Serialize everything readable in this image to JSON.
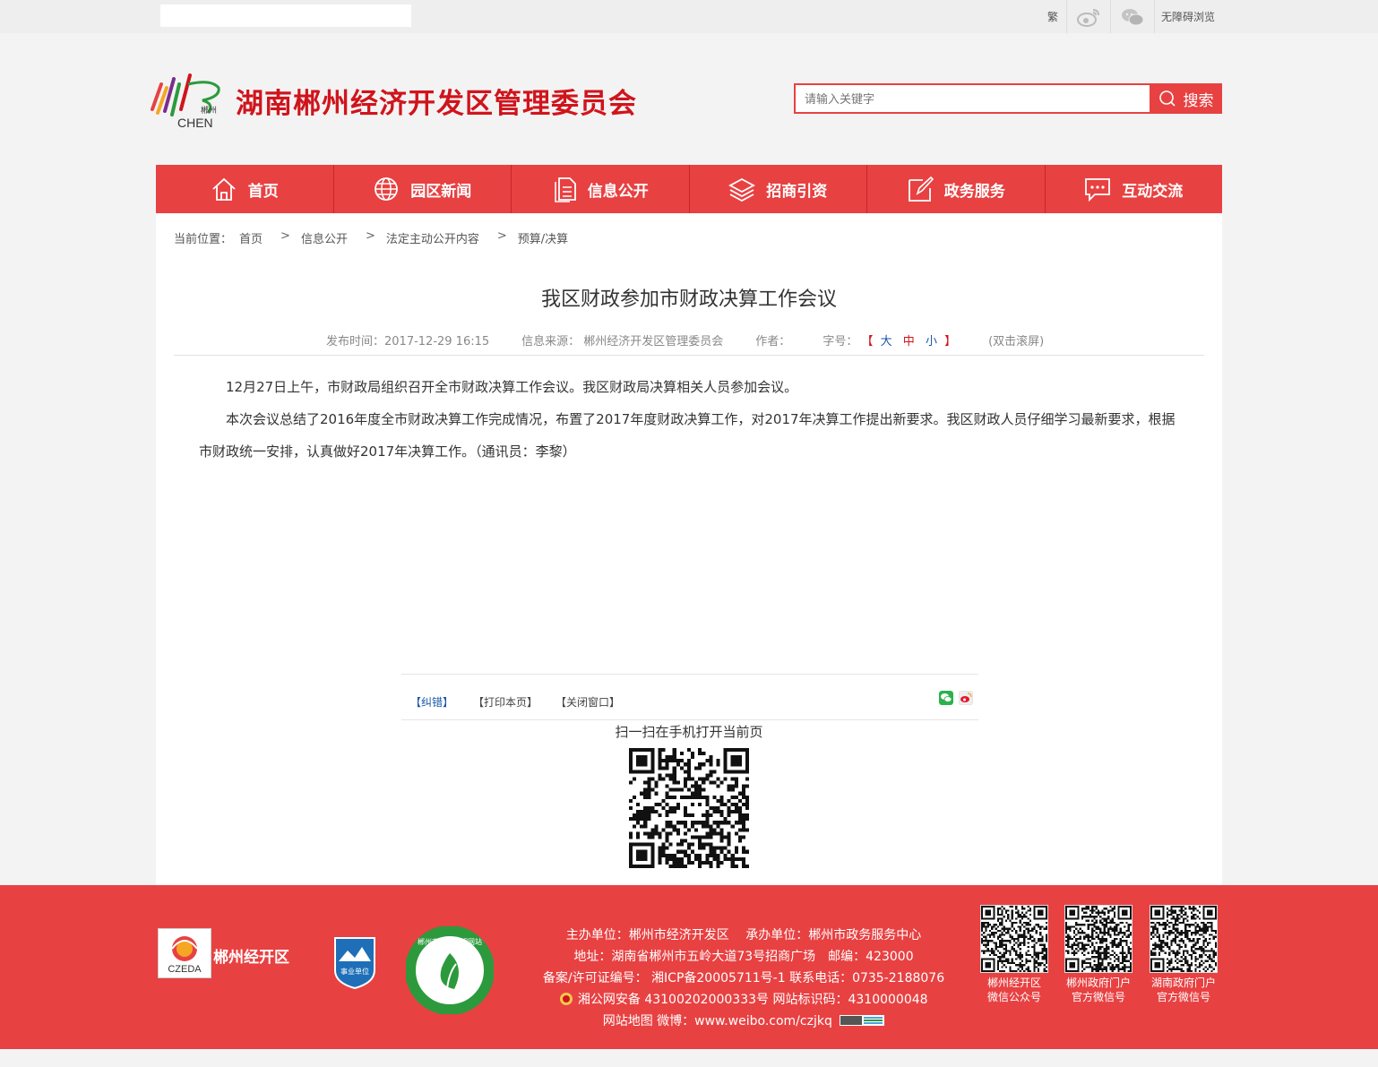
{
  "topbar": {
    "traditional": "繁",
    "weibo_icon": "weibo-icon",
    "wechat_icon": "wechat-icon",
    "accessibility": "无障碍浏览"
  },
  "header": {
    "logo_text_cn": "郴州",
    "logo_text_en": "CHEN",
    "site_title": "湖南郴州经济开发区管理委员会",
    "search_placeholder": "请输入关键字",
    "search_button": "搜索"
  },
  "nav": [
    {
      "label": "首页",
      "icon": "home-icon"
    },
    {
      "label": "园区新闻",
      "icon": "globe-icon"
    },
    {
      "label": "信息公开",
      "icon": "document-icon"
    },
    {
      "label": "招商引资",
      "icon": "layers-icon"
    },
    {
      "label": "政务服务",
      "icon": "edit-icon"
    },
    {
      "label": "互动交流",
      "icon": "chat-icon"
    }
  ],
  "breadcrumb": {
    "label": "当前位置：",
    "items": [
      "首页",
      "信息公开",
      "法定主动公开内容",
      "预算/决算"
    ],
    "separator": ">"
  },
  "article": {
    "title": "我区财政参加市财政决算工作会议",
    "publish_time": "发布时间：2017-12-29 16:15",
    "source": "信息来源： 郴州经济开发区管理委员会",
    "author": "作者：",
    "font_size_label": "字号：",
    "bracket_open": "【",
    "bracket_close": "】",
    "size_large": "大",
    "size_medium": "中",
    "size_small": "小",
    "scroll_hint": "(双击滚屏)",
    "paragraphs": [
      "12月27日上午，市财政局组织召开全市财政决算工作会议。我区财政局决算相关人员参加会议。",
      "本次会议总结了2016年度全市财政决算工作完成情况，布置了2017年度财政决算工作，对2017年决算工作提出新要求。我区财政人员仔细学习最新要求，根据市财政统一安排，认真做好2017年决算工作。（通讯员：李黎）"
    ]
  },
  "tools": {
    "correct": "【纠错】",
    "print": "【打印本页】",
    "close": "【关闭窗口】"
  },
  "qr": {
    "caption": "扫一扫在手机打开当前页"
  },
  "footer": {
    "logo_text": "CZEDA",
    "brand": "郴州经开区",
    "badge_text": "事业单位",
    "seal_text": "郴州市创建文明网站",
    "sponsor": "主办单位：郴州市经济开发区　 承办单位：郴州市政务服务中心",
    "address": "地址：湖南省郴州市五岭大道73号招商广场　邮编：423000",
    "icp": "备案/许可证编号： 湘ICP备20005711号-1 联系电话：0735-2188076",
    "police": "湘公网安备 43100202000333号 网站标识码：4310000048",
    "sitemap": "网站地图 微博：www.weibo.com/czjkq",
    "qrcodes": [
      {
        "line1": "郴州经开区",
        "line2": "微信公众号"
      },
      {
        "line1": "郴州政府门户",
        "line2": "官方微信号"
      },
      {
        "line1": "湖南政府门户",
        "line2": "官方微信号"
      }
    ]
  },
  "colors": {
    "brand_red": "#e84142",
    "title_red": "#d0141c",
    "link_blue": "#1a56a6"
  }
}
